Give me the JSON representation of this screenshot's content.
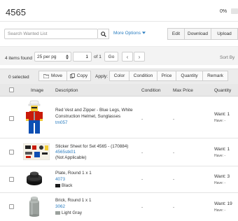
{
  "header": {
    "title": "4565",
    "progress_text": "0%",
    "progress": 0
  },
  "toolbar": {
    "search_placeholder": "Search Wanted List",
    "search_icon": "search-icon",
    "more_options_label": "More Options",
    "edit_label": "Edit",
    "download_label": "Download",
    "upload_label": "Upload"
  },
  "pagination": {
    "items_found": "4 items found",
    "per_page": "25 per pg",
    "page_value": "1",
    "of_pages": "of 1",
    "go_label": "Go",
    "prev_icon": "‹",
    "next_icon": "›",
    "sort_by": "Sort By"
  },
  "actions": {
    "selected_count": "0 selected",
    "move_label": "Move",
    "copy_label": "Copy",
    "apply_label": "Apply:",
    "apply_buttons": [
      "Color",
      "Condition",
      "Price",
      "Quantity",
      "Remark"
    ]
  },
  "table": {
    "columns": [
      "Image",
      "Description",
      "Condition",
      "Max Price",
      "Quantity"
    ],
    "rows": [
      {
        "name": "Red Vest and Zipper - Blue Legs, White Construction Helmet, Sunglasses",
        "id": "tm057",
        "condition": "-",
        "max_price": "-",
        "want": "Want: 1",
        "have": "Have: -"
      },
      {
        "name": "Sticker Sheet for Set 4565 - (170884)",
        "id": "4565stk01",
        "note": "(Not Applicable)",
        "condition": "-",
        "max_price": "-",
        "want": "Want: 1",
        "have": "Have: -"
      },
      {
        "name": "Plate, Round 1 x 1",
        "id": "4073",
        "color": "Black",
        "color_hex": "#1b1b1b",
        "condition": "-",
        "max_price": "-",
        "want": "Want: 3",
        "have": "Have: -"
      },
      {
        "name": "Brick, Round 1 x 1",
        "id": "3062",
        "color": "Light Gray",
        "color_hex": "#9ba19d",
        "condition": "-",
        "max_price": "-",
        "want": "Want: 19",
        "have": "Have: -"
      }
    ]
  },
  "colors": {
    "link": "#2a7dc0",
    "progress": "#2a7dc0"
  }
}
